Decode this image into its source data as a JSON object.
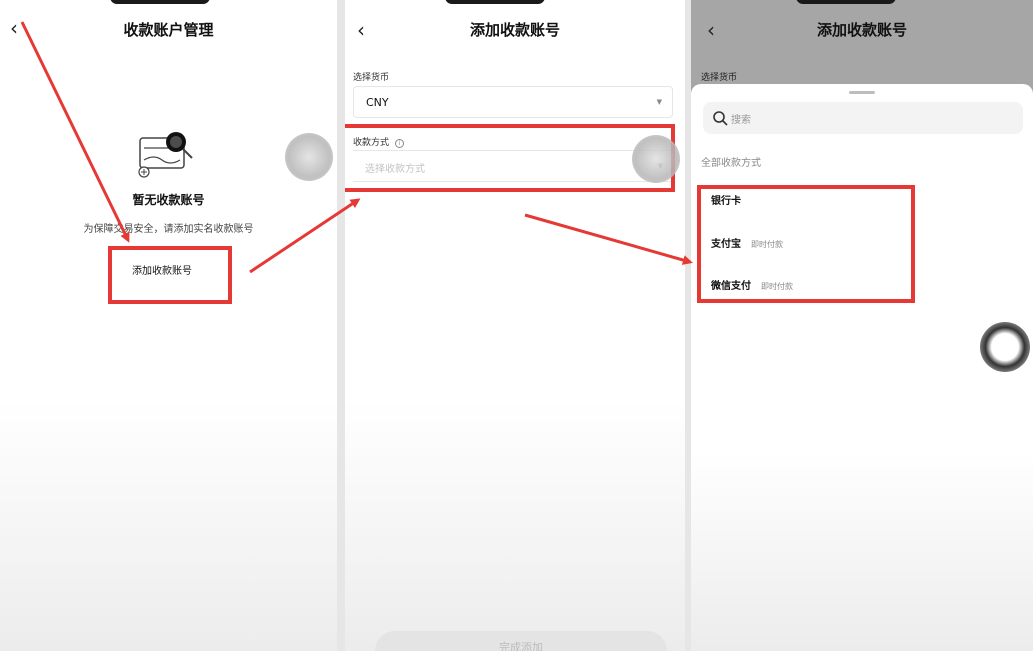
{
  "panel1": {
    "title": "收款账户管理",
    "back": "‹",
    "empty_title": "暂无收款账号",
    "empty_sub": "为保障交易安全，请添加实名收款账号",
    "add_button": "添加收款账号"
  },
  "panel2": {
    "title": "添加收款账号",
    "back": "‹",
    "currency_label": "选择货币",
    "currency_value": "CNY",
    "method_label": "收款方式",
    "method_placeholder": "选择收款方式",
    "bottom_button": "完成添加"
  },
  "panel3": {
    "title": "添加收款账号",
    "back": "‹",
    "currency_label": "选择货币",
    "search_placeholder": "搜索",
    "section": "全部收款方式",
    "items": [
      {
        "label": "银行卡",
        "tag": ""
      },
      {
        "label": "支付宝",
        "tag": "即时付款"
      },
      {
        "label": "微信支付",
        "tag": "即时付款"
      }
    ]
  },
  "colors": {
    "highlight": "#e53935",
    "overlay": "#a6a6a6"
  },
  "icons": [
    "back-arrow-icon",
    "empty-card-search-icon",
    "info-icon",
    "chevron-down-icon",
    "search-icon",
    "touch-indicator-icon"
  ]
}
